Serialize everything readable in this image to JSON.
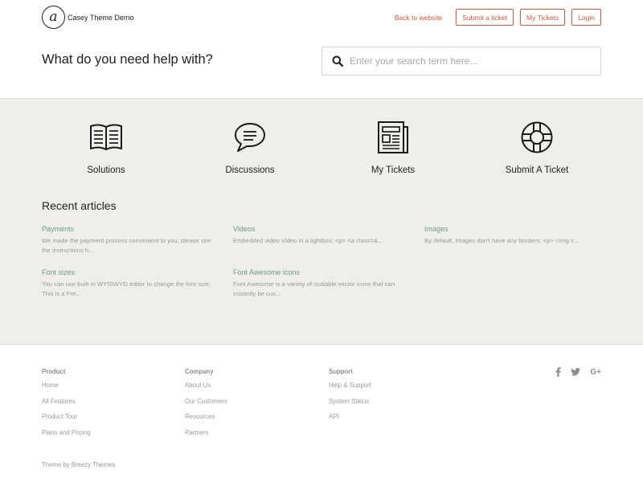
{
  "header": {
    "logo_mark": "a",
    "brand": "Casey Theme Demo",
    "nav": {
      "back_link": "Back to website",
      "submit_ticket": "Submit a ticket",
      "my_tickets": "My Tickets",
      "login": "Login"
    },
    "colors": {
      "accent": "#e0543a"
    }
  },
  "hero": {
    "title": "What do you need help with?",
    "search_placeholder": "Enter your search term here...",
    "search_value": ""
  },
  "tiles": [
    {
      "label": "Solutions",
      "icon": "book-icon"
    },
    {
      "label": "Discussions",
      "icon": "chat-bubble-icon"
    },
    {
      "label": "My Tickets",
      "icon": "newspaper-icon"
    },
    {
      "label": "Submit A Ticket",
      "icon": "lifebuoy-icon"
    }
  ],
  "recent": {
    "title": "Recent articles",
    "articles": [
      {
        "title": "Payments",
        "snippet": "We made the payment process convenient to you, please see the instructions h..."
      },
      {
        "title": "Videos",
        "snippet": "Embedded video Video in a lightbox: <p>   <a class=&..."
      },
      {
        "title": "Images",
        "snippet": "By default, images don't have any borders: <p>   <img s..."
      },
      {
        "title": "Font sizes",
        "snippet": "You can use built-in WYSIWYG editor to change the font size: This is a Fre..."
      },
      {
        "title": "Font Awesome icons",
        "snippet": "Font Awesome is a variety of scalable vector icons that can instantly be cus..."
      }
    ],
    "colors": {
      "title": "#6f9a8d"
    }
  },
  "footer": {
    "columns": [
      {
        "heading": "Product",
        "links": [
          "Home",
          "All Features",
          "Product Tour",
          "Plans and Pricing"
        ]
      },
      {
        "heading": "Company",
        "links": [
          "About Us",
          "Our Customers",
          "Resources",
          "Partners"
        ]
      },
      {
        "heading": "Support",
        "links": [
          "Help & Support",
          "System Status",
          "API"
        ]
      }
    ],
    "social": [
      "facebook-icon",
      "twitter-icon",
      "google-plus-icon"
    ],
    "google_plus_label": "G+",
    "credit": "Theme by Breezy Themes"
  }
}
